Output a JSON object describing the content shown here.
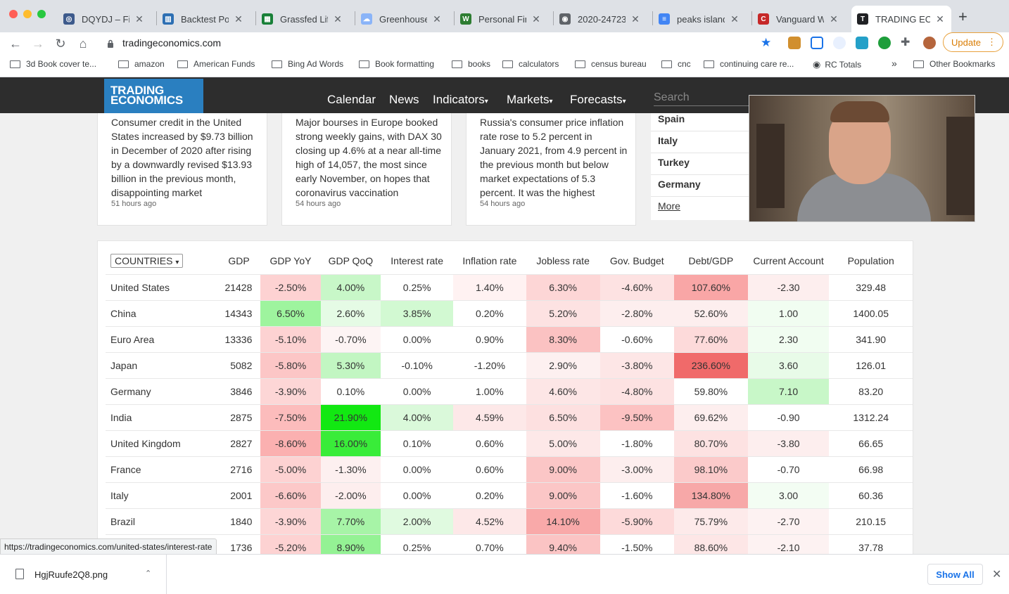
{
  "browser": {
    "tabs": [
      {
        "title": "DQYDJ – Fina",
        "icon": "dqydj-icon",
        "color": "#3d5a8c"
      },
      {
        "title": "Backtest Por",
        "icon": "chart-icon",
        "color": "#2d6fb3"
      },
      {
        "title": "Grassfed Life",
        "icon": "sheets-icon",
        "color": "#188038"
      },
      {
        "title": "Greenhouse",
        "icon": "cloud-icon",
        "color": "#8ab4f8"
      },
      {
        "title": "Personal Fina",
        "icon": "w-icon",
        "color": "#2e7d32"
      },
      {
        "title": "2020-24723",
        "icon": "globe-icon",
        "color": "#5f6368"
      },
      {
        "title": "peaks island",
        "icon": "docs-icon",
        "color": "#4285f4"
      },
      {
        "title": "Vanguard We",
        "icon": "c-icon",
        "color": "#c62828"
      },
      {
        "title": "TRADING EC",
        "icon": "te-icon",
        "color": "#202124"
      }
    ],
    "url": "tradingeconomics.com",
    "update_label": "Update",
    "bookmarks": [
      {
        "label": "3d Book cover te..."
      },
      {
        "label": "amazon"
      },
      {
        "label": "American Funds"
      },
      {
        "label": "Bing Ad Words"
      },
      {
        "label": "Book formatting"
      },
      {
        "label": "books"
      },
      {
        "label": "calculators"
      },
      {
        "label": "census bureau"
      },
      {
        "label": "cnc"
      },
      {
        "label": "continuing care re..."
      },
      {
        "label": "RC Totals"
      }
    ],
    "more_bookmarks": "»",
    "other_bookmarks": "Other Bookmarks",
    "status_url": "https://tradingeconomics.com/united-states/interest-rate"
  },
  "site": {
    "logo": [
      "TRADING",
      "ECONOMICS"
    ],
    "nav": [
      "Calendar",
      "News",
      "Indicators",
      "Markets",
      "Forecasts"
    ],
    "search_placeholder": "Search",
    "news": [
      {
        "text": "Consumer credit in the United States increased by $9.73 billion in December of 2020 after rising by a downwardly revised $13.93 billion in the previous month, disappointing market",
        "ago": "51 hours ago"
      },
      {
        "text": "Major bourses in Europe booked strong weekly gains, with DAX 30 closing up 4.6% at a near all-time high of 14,057, the most since early November, on hopes that coronavirus vaccination",
        "ago": "54 hours ago"
      },
      {
        "text": "Russia's consumer price inflation rate rose to 5.2 percent in January 2021, from 4.9 percent in the previous month but below market expectations of 5.3 percent. It was the highest",
        "ago": "54 hours ago"
      }
    ],
    "side_countries": [
      "Spain",
      "Italy",
      "Turkey",
      "Germany"
    ],
    "side_more": "More"
  },
  "table": {
    "selector": "COUNTRIES",
    "columns": [
      "GDP",
      "GDP YoY",
      "GDP QoQ",
      "Interest rate",
      "Inflation rate",
      "Jobless rate",
      "Gov. Budget",
      "Debt/GDP",
      "Current Account",
      "Population"
    ],
    "rows": [
      [
        "United States",
        "21428",
        "-2.50%",
        "4.00%",
        "0.25%",
        "1.40%",
        "6.30%",
        "-4.60%",
        "107.60%",
        "-2.30",
        "329.48"
      ],
      [
        "China",
        "14343",
        "6.50%",
        "2.60%",
        "3.85%",
        "0.20%",
        "5.20%",
        "-2.80%",
        "52.60%",
        "1.00",
        "1400.05"
      ],
      [
        "Euro Area",
        "13336",
        "-5.10%",
        "-0.70%",
        "0.00%",
        "0.90%",
        "8.30%",
        "-0.60%",
        "77.60%",
        "2.30",
        "341.90"
      ],
      [
        "Japan",
        "5082",
        "-5.80%",
        "5.30%",
        "-0.10%",
        "-1.20%",
        "2.90%",
        "-3.80%",
        "236.60%",
        "3.60",
        "126.01"
      ],
      [
        "Germany",
        "3846",
        "-3.90%",
        "0.10%",
        "0.00%",
        "1.00%",
        "4.60%",
        "-4.80%",
        "59.80%",
        "7.10",
        "83.20"
      ],
      [
        "India",
        "2875",
        "-7.50%",
        "21.90%",
        "4.00%",
        "4.59%",
        "6.50%",
        "-9.50%",
        "69.62%",
        "-0.90",
        "1312.24"
      ],
      [
        "United Kingdom",
        "2827",
        "-8.60%",
        "16.00%",
        "0.10%",
        "0.60%",
        "5.00%",
        "-1.80%",
        "80.70%",
        "-3.80",
        "66.65"
      ],
      [
        "France",
        "2716",
        "-5.00%",
        "-1.30%",
        "0.00%",
        "0.60%",
        "9.00%",
        "-3.00%",
        "98.10%",
        "-0.70",
        "66.98"
      ],
      [
        "Italy",
        "2001",
        "-6.60%",
        "-2.00%",
        "0.00%",
        "0.20%",
        "9.00%",
        "-1.60%",
        "134.80%",
        "3.00",
        "60.36"
      ],
      [
        "Brazil",
        "1840",
        "-3.90%",
        "7.70%",
        "2.00%",
        "4.52%",
        "14.10%",
        "-5.90%",
        "75.79%",
        "-2.70",
        "210.15"
      ],
      [
        "",
        "1736",
        "-5.20%",
        "8.90%",
        "0.25%",
        "0.70%",
        "9.40%",
        "-1.50%",
        "88.60%",
        "-2.10",
        "37.78"
      ]
    ],
    "colors": [
      [
        "",
        "",
        "#fdd2d2",
        "#c8f7c8",
        "#fff",
        "#fff2f2",
        "#fdd6d6",
        "#fde2e2",
        "#f9a6a6",
        "#fdeeee",
        "#fff"
      ],
      [
        "",
        "",
        "#9ef49e",
        "#e5fbe5",
        "#d2f9d2",
        "#fff",
        "#fde2e2",
        "#fdeeee",
        "#fdeeee",
        "#f1fdf1",
        "#fff"
      ],
      [
        "",
        "",
        "#fdd2d2",
        "#fdf4f4",
        "#fff",
        "#fff",
        "#fbc2c2",
        "#fff",
        "#fddada",
        "#f1fdf1",
        "#fff"
      ],
      [
        "",
        "",
        "#fcc6c6",
        "#c2f6c2",
        "#fff",
        "#fff",
        "#fdf0f0",
        "#fde6e6",
        "#f06a6a",
        "#e8fbe8",
        "#fff"
      ],
      [
        "",
        "",
        "#fdd6d6",
        "#fff",
        "#fff",
        "#fff",
        "#fde6e6",
        "#fde2e2",
        "#fff",
        "#c8f7c8",
        "#fff"
      ],
      [
        "",
        "",
        "#fcbcbc",
        "#12e812",
        "#daf9da",
        "#fde8e8",
        "#fde0e0",
        "#fcc2c2",
        "#fdeeee",
        "#fff",
        "#fff"
      ],
      [
        "",
        "",
        "#fbb0b0",
        "#39ec39",
        "#fff",
        "#fff",
        "#fde8e8",
        "#fff",
        "#fde2e2",
        "#fdeeee",
        "#fff"
      ],
      [
        "",
        "",
        "#fdd2d2",
        "#fdf0f0",
        "#fff",
        "#fff",
        "#fbc6c6",
        "#fdeeee",
        "#fbcaca",
        "#fff",
        "#fff"
      ],
      [
        "",
        "",
        "#fcc8c8",
        "#fdeeee",
        "#fff",
        "#fff",
        "#fbc6c6",
        "#fff",
        "#f7a8a8",
        "#f3fdf3",
        "#fff"
      ],
      [
        "",
        "",
        "#fdd6d6",
        "#a7f4a7",
        "#e0fae0",
        "#fde8e8",
        "#f9a9a9",
        "#fddada",
        "#fdeaea",
        "#fdf2f2",
        "#fff"
      ],
      [
        "",
        "",
        "#fdd2d2",
        "#94f294",
        "#fff",
        "#fff",
        "#fbc4c4",
        "#fff",
        "#fde6e6",
        "#fdf2f2",
        "#fff"
      ]
    ]
  },
  "downloads": {
    "file": "HgjRuufe2Q8.png",
    "show_all": "Show All"
  }
}
